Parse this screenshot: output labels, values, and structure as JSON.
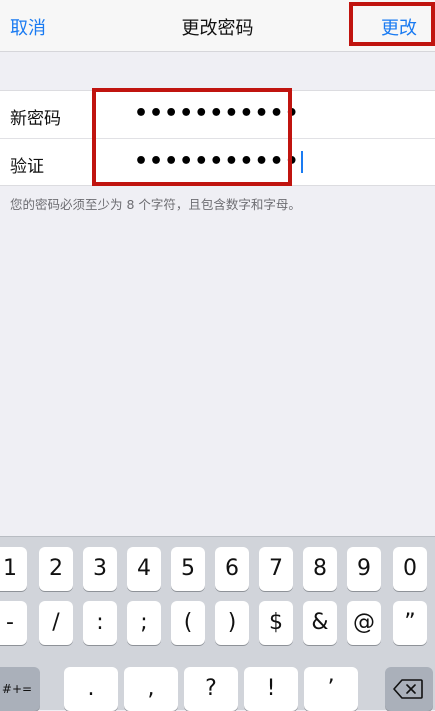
{
  "nav": {
    "cancel": "取消",
    "title": "更改密码",
    "save": "更改"
  },
  "form": {
    "new_password": {
      "label": "新密码",
      "value": "•••••••••••"
    },
    "verify": {
      "label": "验证",
      "value": "•••••••••••"
    }
  },
  "hint": "您的密码必须至少为 8 个字符，且包含数字和字母。",
  "keyboard": {
    "row1": [
      "1",
      "2",
      "3",
      "4",
      "5",
      "6",
      "7",
      "8",
      "9",
      "0"
    ],
    "row2": [
      "-",
      "/",
      ":",
      ";",
      "(",
      ")",
      "$",
      "&",
      "@",
      "”"
    ],
    "row3": {
      "toggle": "#+=",
      "keys": [
        ".",
        ",",
        "?",
        "!",
        "’"
      ]
    }
  },
  "icons": {
    "backspace": "backspace-icon"
  },
  "colors": {
    "accent": "#1a7bf2",
    "highlight": "#c0140f"
  }
}
